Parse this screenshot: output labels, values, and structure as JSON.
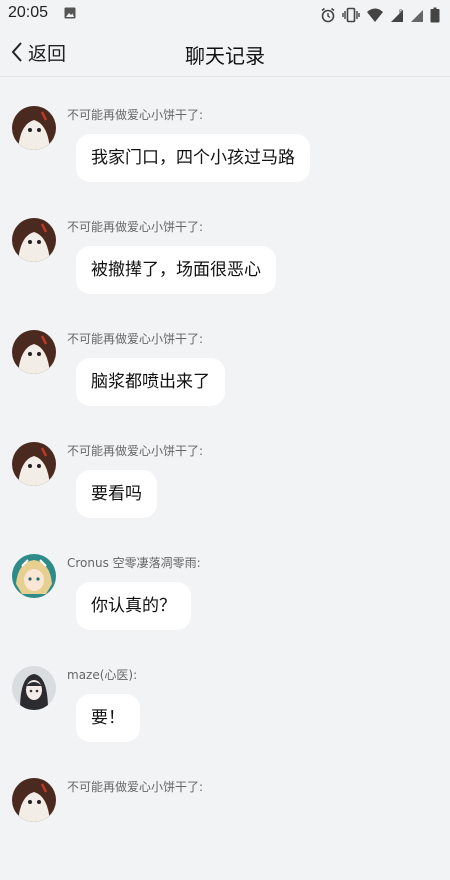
{
  "status_bar": {
    "time": "20:05",
    "icons": [
      "image-icon",
      "alarm-icon",
      "vibrate-icon",
      "wifi-icon",
      "signal-icon",
      "signal-icon",
      "battery-icon"
    ]
  },
  "header": {
    "back_label": "返回",
    "title": "聊天记录"
  },
  "messages": [
    {
      "sender": "不可能再做爱心小饼干了:",
      "text": "我家门口，四个小孩过马路",
      "avatar": "avatar-cookie"
    },
    {
      "sender": "不可能再做爱心小饼干了:",
      "text": "被撤撵了，场面很恶心",
      "avatar": "avatar-cookie"
    },
    {
      "sender": "不可能再做爱心小饼干了:",
      "text": "脑浆都喷出来了",
      "avatar": "avatar-cookie"
    },
    {
      "sender": "不可能再做爱心小饼干了:",
      "text": "要看吗",
      "avatar": "avatar-cookie"
    },
    {
      "sender": "Cronus 空零凄落凋零雨:",
      "text": "你认真的？",
      "avatar": "avatar-cronus"
    },
    {
      "sender": "maze(心医):",
      "text": "要！",
      "avatar": "avatar-maze"
    },
    {
      "sender": "不可能再做爱心小饼干了:",
      "text": "",
      "avatar": "avatar-cookie"
    }
  ],
  "colors": {
    "background": "#f2f3f5",
    "bubble": "#ffffff",
    "sender_text": "#666666"
  }
}
